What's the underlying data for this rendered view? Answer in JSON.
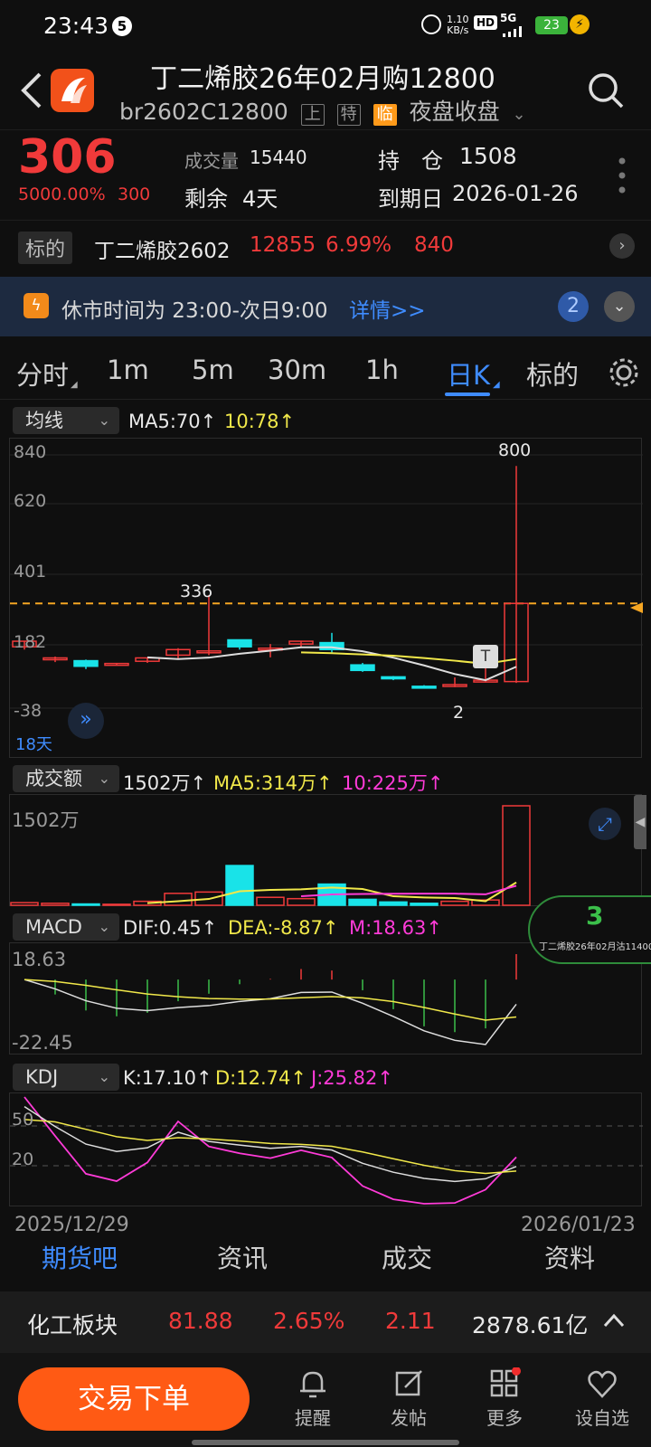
{
  "status": {
    "time": "23:43",
    "notif_count": "5",
    "net_speed_top": "1.10",
    "net_speed_bottom": "KB/s",
    "hd": "HD",
    "signal": "5G",
    "battery": "23"
  },
  "header": {
    "title": "丁二烯胶26年02月购12800",
    "code": "br2602C12800",
    "badge1": "上",
    "badge2": "特",
    "badge3": "临",
    "session": "夜盘收盘"
  },
  "quote": {
    "price": "306",
    "change_pct": "5000.00%",
    "change": "300",
    "vol_label": "成交量",
    "vol": "15440",
    "remain_label": "剩余",
    "remain": "4天",
    "hold_label": "持　仓",
    "hold": "1508",
    "expire_label": "到期日",
    "expire": "2026-01-26"
  },
  "underlying": {
    "label": "标的",
    "name": "丁二烯胶2602",
    "price": "12855",
    "pct": "6.99%",
    "change": "840"
  },
  "notice": {
    "text": "休市时间为 23:00-次日9:00",
    "link": "详情>>",
    "count": "2"
  },
  "tabs": [
    "分时",
    "1m",
    "5m",
    "30m",
    "1h",
    "日K",
    "标的"
  ],
  "kline": {
    "selector": "均线",
    "ma5": "MA5:70↑",
    "ma10": "10:78↑",
    "y_top": "840",
    "y2": "620",
    "y3": "401",
    "y4": "182",
    "y_bottom": "-38",
    "high_label": "800",
    "peak_label": "336",
    "low_label": "2",
    "days": "18天",
    "t_marker": "T"
  },
  "volume": {
    "selector": "成交额",
    "val": "1502万↑",
    "ma5": "MA5:314万↑",
    "ma10": "10:225万↑",
    "y_top": "1502万"
  },
  "macd": {
    "selector": "MACD",
    "dif": "DIF:0.45↑",
    "dea": "DEA:-8.87↑",
    "m": "M:18.63↑",
    "y_top": "18.63",
    "y_bottom": "-22.45"
  },
  "kdj": {
    "selector": "KDJ",
    "k": "K:17.10↑",
    "d": "D:12.74↑",
    "j": "J:25.82↑",
    "y50": "50",
    "y20": "20"
  },
  "dates": {
    "start": "2025/12/29",
    "end": "2026/01/23"
  },
  "float_card": {
    "num": "3",
    "text": "丁二烯胶26年02月沽11400"
  },
  "bottom_tabs": [
    "期货吧",
    "资讯",
    "成交",
    "资料"
  ],
  "sector": {
    "name": "化工板块",
    "value": "81.88",
    "pct": "2.65%",
    "change": "2.11",
    "amount": "2878.61亿"
  },
  "actions": {
    "trade": "交易下单",
    "remind": "提醒",
    "post": "发帖",
    "more": "更多",
    "watch": "设自选"
  },
  "chart_data": {
    "type": "candlestick",
    "candles": [
      [
        150,
        170,
        172,
        140
      ],
      [
        105,
        110,
        115,
        95
      ],
      [
        100,
        80,
        104,
        70
      ],
      [
        90,
        90,
        92,
        85
      ],
      [
        98,
        110,
        112,
        92
      ],
      [
        120,
        140,
        145,
        104
      ],
      [
        130,
        135,
        336,
        120
      ],
      [
        175,
        150,
        176,
        140
      ],
      [
        140,
        145,
        160,
        112
      ],
      [
        160,
        170,
        172,
        150
      ],
      [
        165,
        140,
        200,
        130
      ],
      [
        85,
        65,
        92,
        60
      ],
      [
        42,
        35,
        45,
        30
      ],
      [
        8,
        6,
        12,
        2
      ],
      [
        10,
        14,
        40,
        5
      ],
      [
        30,
        30,
        82,
        22
      ],
      [
        25,
        306,
        800,
        20
      ]
    ],
    "volume": [
      40,
      30,
      20,
      15,
      60,
      180,
      200,
      600,
      120,
      100,
      320,
      90,
      50,
      30,
      60,
      80,
      1502
    ]
  }
}
